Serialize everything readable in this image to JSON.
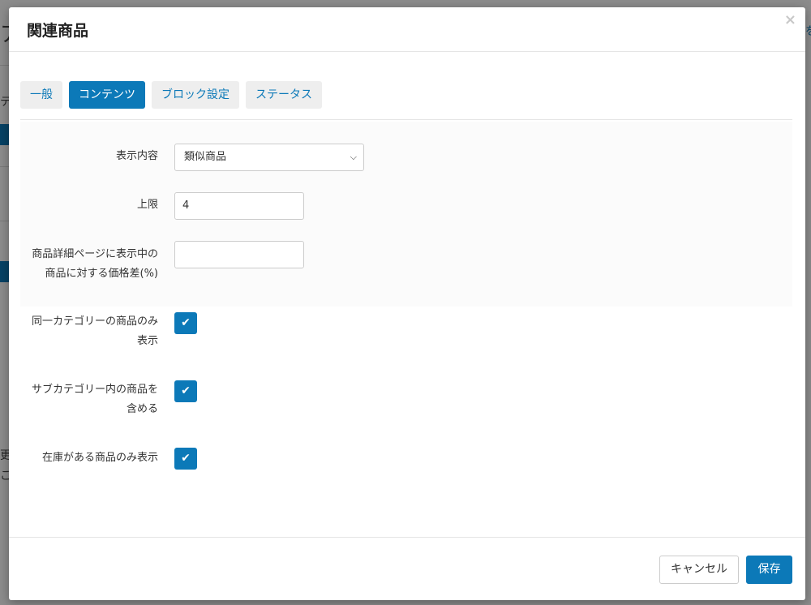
{
  "modal": {
    "title": "関連商品",
    "close_icon": "×"
  },
  "tabs": [
    {
      "label": "一般",
      "active": false
    },
    {
      "label": "コンテンツ",
      "active": true
    },
    {
      "label": "ブロック設定",
      "active": false
    },
    {
      "label": "ステータス",
      "active": false
    }
  ],
  "form": {
    "display_content": {
      "label": "表示内容",
      "value": "類似商品"
    },
    "limit": {
      "label": "上限",
      "value": "4"
    },
    "price_diff": {
      "label_line1": "商品詳細ページに表示中の",
      "label_line2": "商品に対する価格差(%)",
      "value": ""
    },
    "same_category": {
      "label_line1": "同一カテゴリーの商品のみ",
      "label_line2": "表示",
      "checked": true
    },
    "include_subcategory": {
      "label_line1": "サブカテゴリー内の商品を",
      "label_line2": "含める",
      "checked": true
    },
    "in_stock_only": {
      "label": "在庫がある商品のみ表示",
      "checked": true
    }
  },
  "footer": {
    "cancel_label": "キャンセル",
    "save_label": "保存"
  },
  "background": {
    "glyphs": [
      "ア",
      "テ",
      "更",
      "こ",
      "を"
    ]
  },
  "colors": {
    "accent": "#0c79b8",
    "tab_inactive_bg": "#eeeeee"
  }
}
